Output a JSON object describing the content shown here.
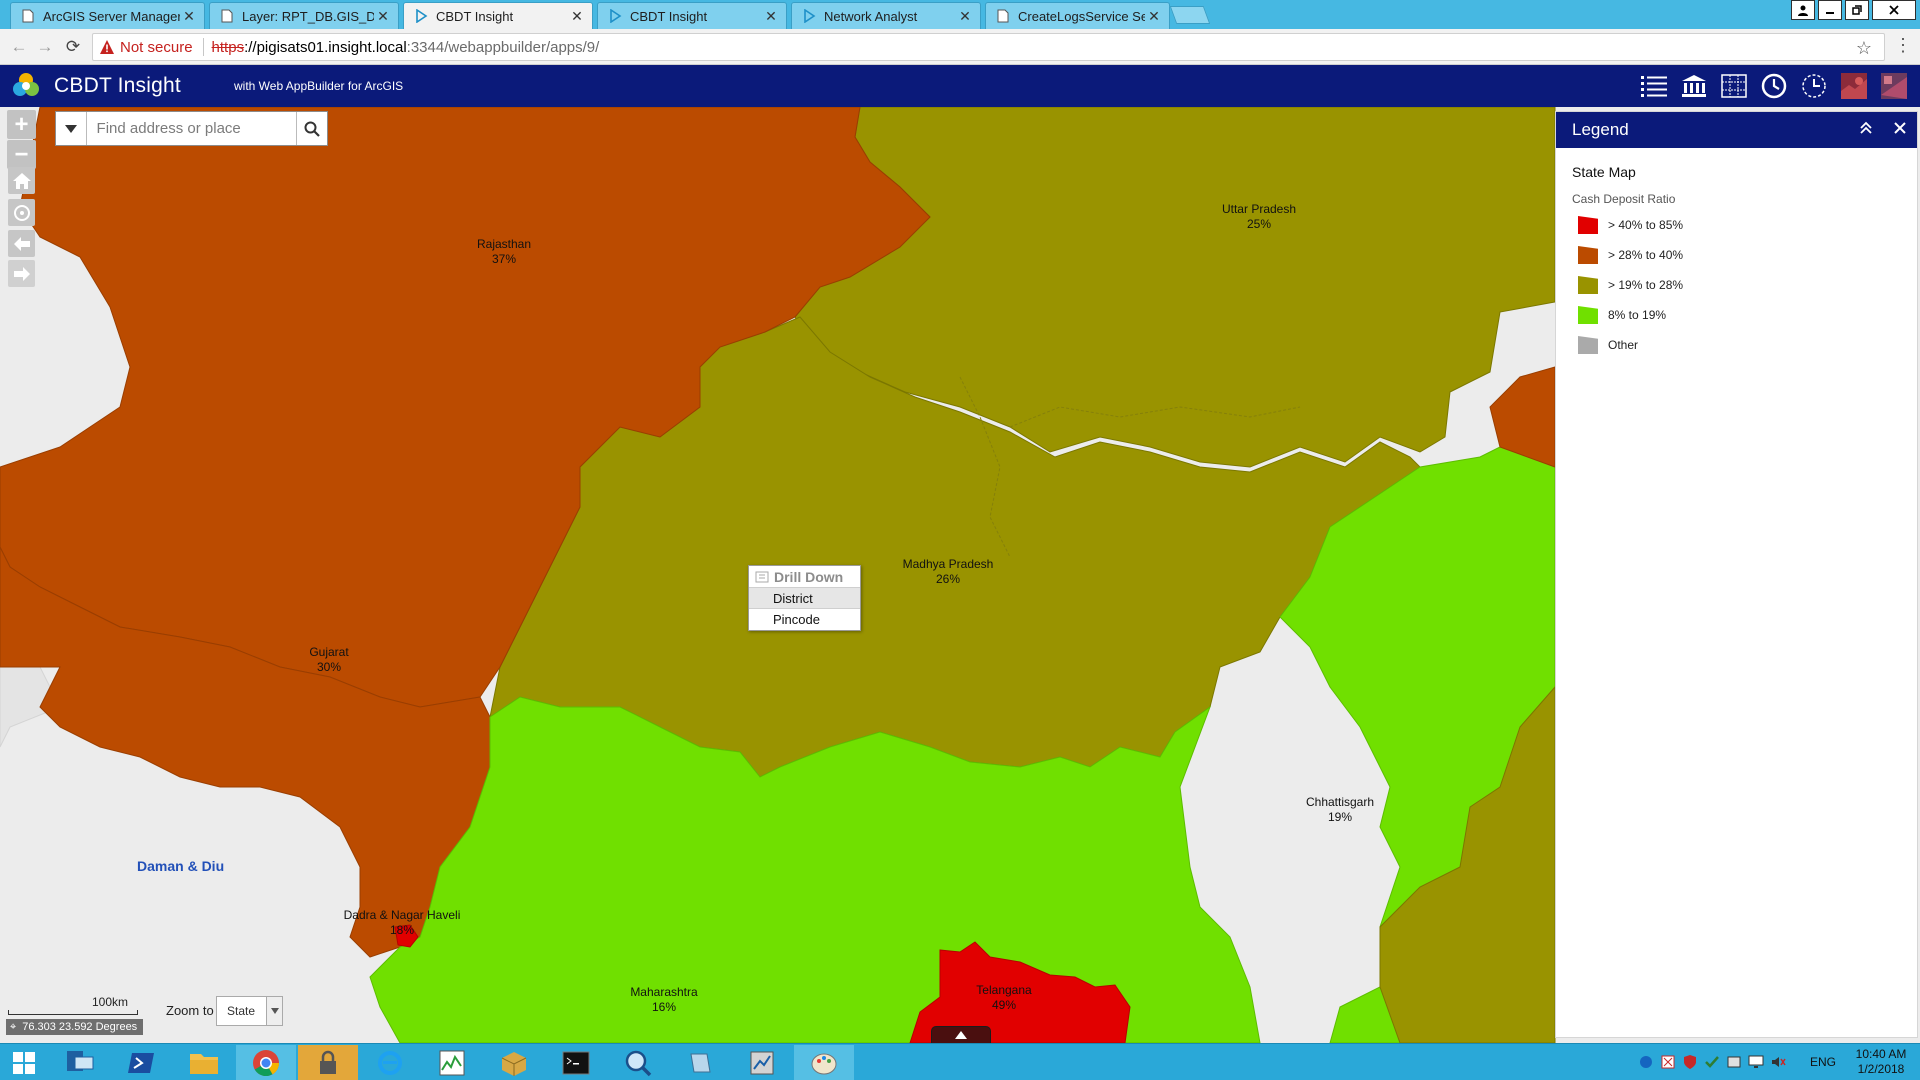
{
  "browser": {
    "tabs": [
      {
        "title": "ArcGIS Server Manager",
        "active": false
      },
      {
        "title": "Layer: RPT_DB.GIS_DISTR",
        "active": false
      },
      {
        "title": "CBDT Insight",
        "active": true
      },
      {
        "title": "CBDT Insight",
        "active": false
      },
      {
        "title": "Network Analyst",
        "active": false
      },
      {
        "title": "CreateLogsService Servic",
        "active": false
      }
    ],
    "security_label": "Not secure",
    "url_scheme": "https",
    "url_host": "://pigisats01.insight.local",
    "url_path": ":3344/webappbuilder/apps/9/"
  },
  "app": {
    "title": "CBDT Insight",
    "subtitle": "with Web AppBuilder for ArcGIS",
    "header_icons": [
      "list-icon",
      "bank-icon",
      "grid-map-icon",
      "history-icon",
      "time-slider-icon",
      "thumbnail-1-icon",
      "thumbnail-2-icon"
    ]
  },
  "search": {
    "placeholder": "Find address or place"
  },
  "map": {
    "states": [
      {
        "name": "Rajasthan",
        "value": "37%"
      },
      {
        "name": "Uttar Pradesh",
        "value": "25%"
      },
      {
        "name": "Madhya Pradesh",
        "value": "26%"
      },
      {
        "name": "Gujarat",
        "value": "30%"
      },
      {
        "name": "Chhattisgarh",
        "value": "19%"
      },
      {
        "name": "Dadra & Nagar Haveli",
        "value": "18%"
      },
      {
        "name": "Maharashtra",
        "value": "16%"
      },
      {
        "name": "Telangana",
        "value": "49%"
      }
    ],
    "basemap_labels": {
      "daman": "Daman & Diu"
    },
    "colors": {
      "high": "#e10000",
      "mid_high": "#bb4b00",
      "mid": "#999300",
      "low": "#70e000",
      "other": "#aaaaaa"
    }
  },
  "context_menu": {
    "title": "Drill Down",
    "items": [
      "District",
      "Pincode"
    ]
  },
  "legend": {
    "title": "Legend",
    "layer": "State Map",
    "field": "Cash Deposit Ratio",
    "items": [
      {
        "label": "> 40% to 85%",
        "color": "#e10000"
      },
      {
        "label": "> 28% to 40%",
        "color": "#bb4b00"
      },
      {
        "label": "> 19% to 28%",
        "color": "#999300"
      },
      {
        "label": "8% to 19%",
        "color": "#70e000"
      },
      {
        "label": "Other",
        "color": "#aaaaaa"
      }
    ]
  },
  "scalebar": {
    "label": "100km"
  },
  "coordinates": "76.303 23.592 Degrees",
  "zoom_to": {
    "label": "Zoom to",
    "value": "State"
  },
  "taskbar": {
    "language": "ENG",
    "time": "10:40 AM",
    "date": "1/2/2018"
  }
}
